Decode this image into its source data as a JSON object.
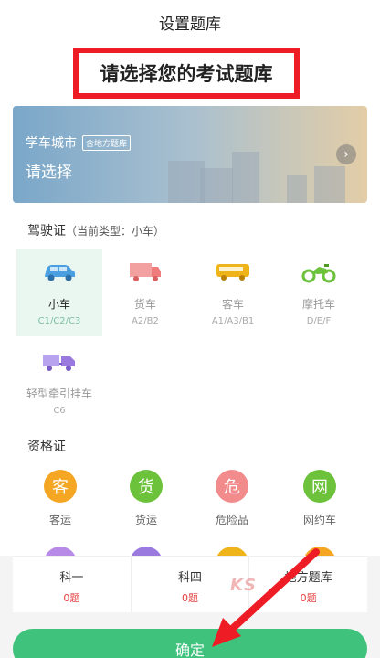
{
  "header": {
    "title": "设置题库"
  },
  "prompt": "请选择您的考试题库",
  "banner": {
    "city": "学车城市",
    "tag": "含地方题库",
    "choose": "请选择"
  },
  "license": {
    "title": "驾驶证",
    "subtitle": "（当前类型：小车）",
    "vehicles": [
      {
        "name": "小车",
        "code": "C1/C2/C3",
        "icon": "car-icon",
        "color": "#4a9fe0"
      },
      {
        "name": "货车",
        "code": "A2/B2",
        "icon": "truck-icon",
        "color": "#f07b7b"
      },
      {
        "name": "客车",
        "code": "A1/A3/B1",
        "icon": "bus-icon",
        "color": "#f0b41b"
      },
      {
        "name": "摩托车",
        "code": "D/E/F",
        "icon": "motorcycle-icon",
        "color": "#6cc23a"
      },
      {
        "name": "轻型牵引挂车",
        "code": "C6",
        "icon": "trailer-icon",
        "color": "#9b7ae0"
      }
    ]
  },
  "qualification": {
    "title": "资格证",
    "items": [
      {
        "char": "客",
        "name": "客运",
        "color": "#f5a623"
      },
      {
        "char": "货",
        "name": "货运",
        "color": "#6cc23a"
      },
      {
        "char": "危",
        "name": "危险品",
        "color": "#f28b8b"
      },
      {
        "char": "网",
        "name": "网约车",
        "color": "#6cc23a"
      }
    ]
  },
  "stats": [
    {
      "label": "科一",
      "value": "0题"
    },
    {
      "label": "科四",
      "value": "0题"
    },
    {
      "label": "地方题库",
      "value": "0题"
    }
  ],
  "watermark": "KS",
  "confirm": "确定"
}
